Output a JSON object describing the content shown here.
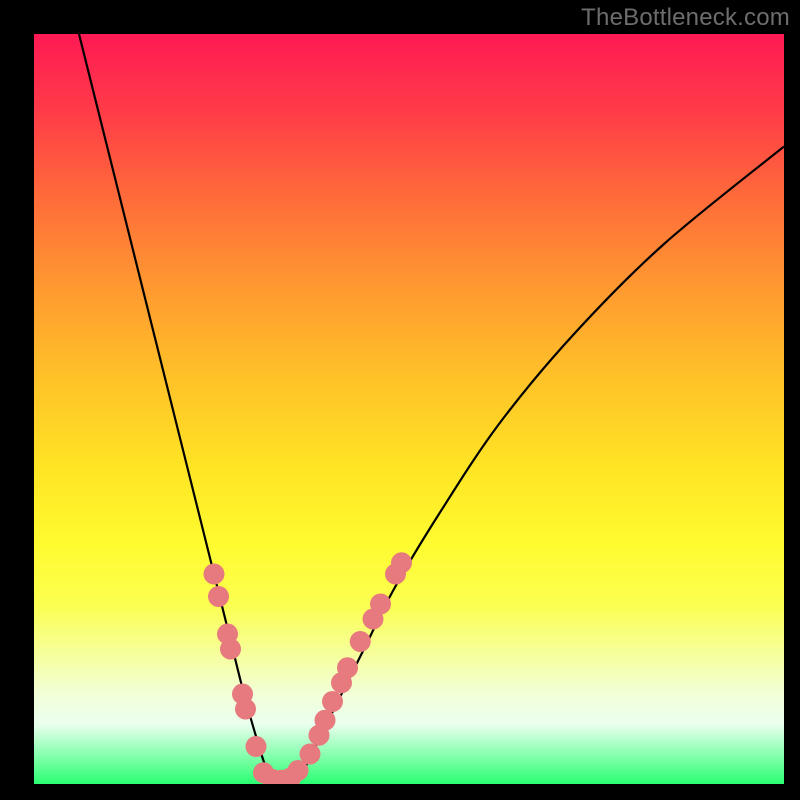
{
  "watermark": "TheBottleneck.com",
  "colors": {
    "dot": "#e77a7f",
    "line": "#000000",
    "frame": "#000000"
  },
  "chart_data": {
    "type": "line",
    "title": "",
    "xlabel": "",
    "ylabel": "",
    "xlim": [
      0,
      100
    ],
    "ylim": [
      0,
      100
    ],
    "grid": false,
    "series": [
      {
        "name": "bottleneck-curve",
        "x": [
          6,
          10,
          14,
          18,
          22,
          24,
          26,
          28,
          30,
          31,
          32,
          33,
          34,
          36,
          38,
          40,
          44,
          48,
          54,
          62,
          72,
          84,
          100
        ],
        "y": [
          100,
          84,
          68,
          52,
          36,
          28,
          20,
          12,
          5,
          2,
          0,
          0,
          0,
          2,
          6,
          10,
          18,
          26,
          36,
          48,
          60,
          72,
          85
        ]
      }
    ],
    "markers": [
      {
        "name": "left-cluster",
        "points": [
          {
            "x": 24.0,
            "y": 28
          },
          {
            "x": 24.6,
            "y": 25
          },
          {
            "x": 25.8,
            "y": 20
          },
          {
            "x": 26.2,
            "y": 18
          },
          {
            "x": 27.8,
            "y": 12
          },
          {
            "x": 28.2,
            "y": 10
          },
          {
            "x": 29.6,
            "y": 5
          }
        ]
      },
      {
        "name": "valley",
        "points": [
          {
            "x": 30.6,
            "y": 1.5
          },
          {
            "x": 31.8,
            "y": 0.6
          },
          {
            "x": 33.0,
            "y": 0.5
          },
          {
            "x": 34.2,
            "y": 0.8
          },
          {
            "x": 35.2,
            "y": 1.8
          }
        ]
      },
      {
        "name": "right-cluster",
        "points": [
          {
            "x": 36.8,
            "y": 4
          },
          {
            "x": 38.0,
            "y": 6.5
          },
          {
            "x": 38.8,
            "y": 8.5
          },
          {
            "x": 39.8,
            "y": 11
          },
          {
            "x": 41.0,
            "y": 13.5
          },
          {
            "x": 41.8,
            "y": 15.5
          },
          {
            "x": 43.5,
            "y": 19
          },
          {
            "x": 45.2,
            "y": 22
          },
          {
            "x": 46.2,
            "y": 24
          },
          {
            "x": 48.2,
            "y": 28
          },
          {
            "x": 49.0,
            "y": 29.5
          }
        ]
      }
    ]
  }
}
